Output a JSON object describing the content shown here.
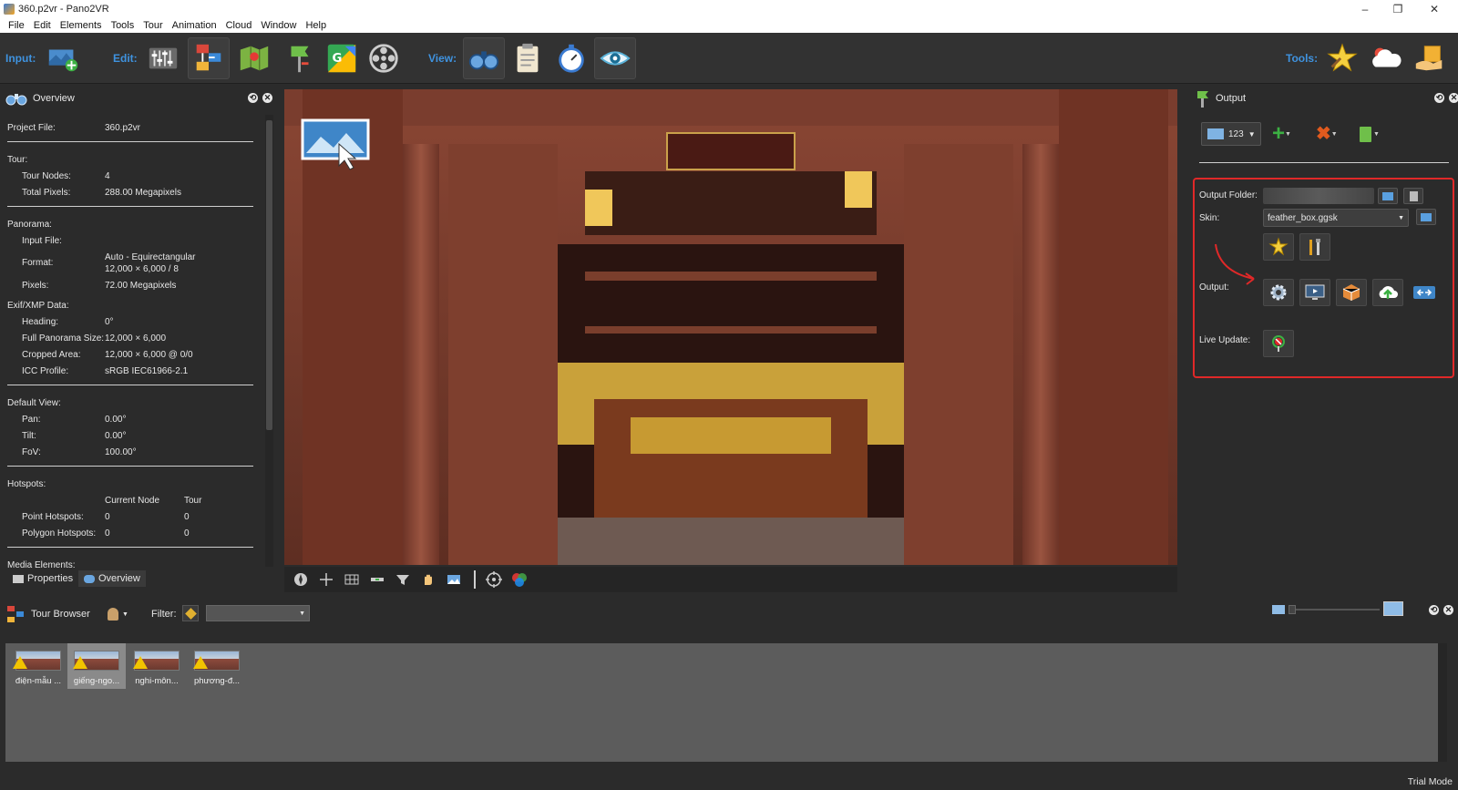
{
  "window": {
    "title": "360.p2vr - Pano2VR",
    "minimize": "–",
    "maximize": "❐",
    "close": "✕"
  },
  "menu": [
    "File",
    "Edit",
    "Elements",
    "Tools",
    "Tour",
    "Animation",
    "Cloud",
    "Window",
    "Help"
  ],
  "toolbar": {
    "input_label": "Input:",
    "edit_label": "Edit:",
    "view_label": "View:",
    "tools_label": "Tools:"
  },
  "overview": {
    "title": "Overview",
    "project_file_label": "Project File:",
    "project_file": "360.p2vr",
    "tour_heading": "Tour:",
    "tour_nodes_label": "Tour Nodes:",
    "tour_nodes": "4",
    "total_pixels_label": "Total Pixels:",
    "total_pixels": "288.00 Megapixels",
    "panorama_heading": "Panorama:",
    "input_file_label": "Input File:",
    "format_label": "Format:",
    "format_line1": "Auto - Equirectangular",
    "format_line2": "12,000 × 6,000 / 8",
    "pixels_label": "Pixels:",
    "pixels": "72.00 Megapixels",
    "exif_heading": "Exif/XMP Data:",
    "heading_label": "Heading:",
    "heading": "0°",
    "full_size_label": "Full Panorama Size:",
    "full_size": "12,000 × 6,000",
    "cropped_label": "Cropped Area:",
    "cropped": "12,000 × 6,000 @ 0/0",
    "icc_label": "ICC Profile:",
    "icc": "sRGB IEC61966-2.1",
    "default_view_heading": "Default View:",
    "pan_label": "Pan:",
    "pan": "0.00°",
    "tilt_label": "Tilt:",
    "tilt": "0.00°",
    "fov_label": "FoV:",
    "fov": "100.00°",
    "hotspots_heading": "Hotspots:",
    "col_current": "Current Node",
    "col_tour": "Tour",
    "point_label": "Point Hotspots:",
    "point_current": "0",
    "point_tour": "0",
    "polygon_label": "Polygon Hotspots:",
    "polygon_current": "0",
    "polygon_tour": "0",
    "media_heading": "Media Elements:",
    "tab_properties": "Properties",
    "tab_overview": "Overview"
  },
  "output": {
    "title": "Output",
    "format_value": "123",
    "output_folder_label": "Output Folder:",
    "skin_label": "Skin:",
    "skin_value": "feather_box.ggsk",
    "output_label": "Output:",
    "live_update_label": "Live Update:",
    "highlight_color": "#e02828"
  },
  "tour_browser": {
    "title": "Tour Browser",
    "filter_label": "Filter:",
    "filter_value": "",
    "thumbs": [
      {
        "label": "điện-mẫu ..."
      },
      {
        "label": "giếng-ngo..."
      },
      {
        "label": "nghi-môn..."
      },
      {
        "label": "phương-đ..."
      }
    ]
  },
  "status": {
    "mode": "Trial Mode"
  },
  "colors": {
    "accent_blue": "#3f93e0",
    "panel_bg": "#2b2b2b",
    "tour_bg": "#5c5c5c"
  }
}
